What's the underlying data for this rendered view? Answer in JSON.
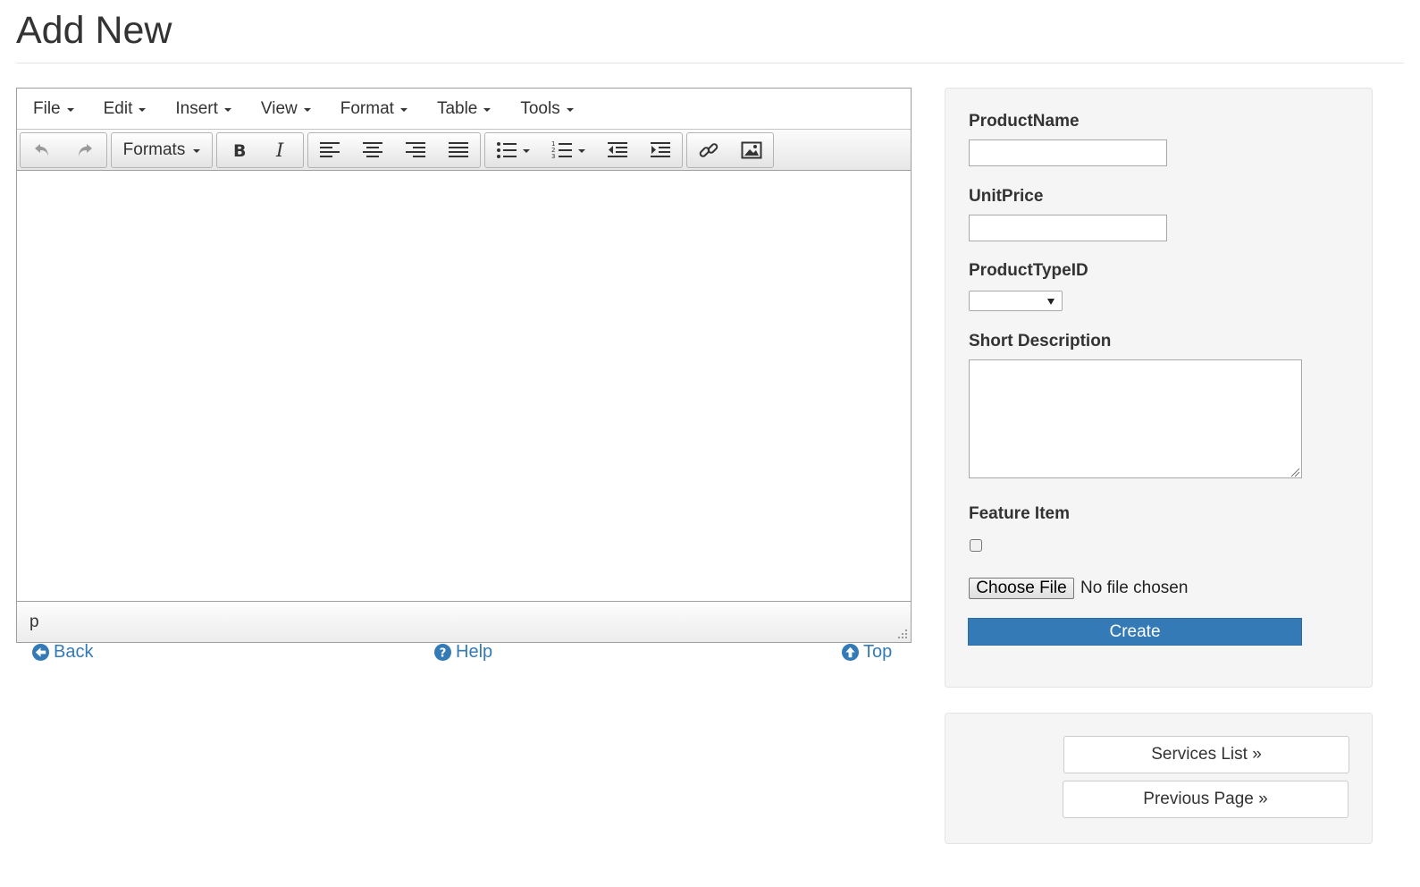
{
  "page": {
    "title": "Add New"
  },
  "editor": {
    "menu": [
      "File",
      "Edit",
      "Insert",
      "View",
      "Format",
      "Table",
      "Tools"
    ],
    "formats_label": "Formats",
    "status_path": "p"
  },
  "links": {
    "back": "Back",
    "help": "Help",
    "top": "Top"
  },
  "form": {
    "product_name_label": "ProductName",
    "product_name_value": "",
    "unit_price_label": "UnitPrice",
    "unit_price_value": "",
    "product_type_label": "ProductTypeID",
    "product_type_selected": "",
    "short_description_label": "Short Description",
    "short_description_value": "",
    "feature_item_label": "Feature Item",
    "feature_item_checked": false,
    "choose_file_label": "Choose File",
    "file_status": "No file chosen",
    "create_label": "Create"
  },
  "nav": {
    "services_list": "Services List »",
    "previous_page": "Previous Page »"
  },
  "colors": {
    "primary": "#337ab7",
    "link": "#337ab7",
    "panel_bg": "#f5f5f5"
  }
}
